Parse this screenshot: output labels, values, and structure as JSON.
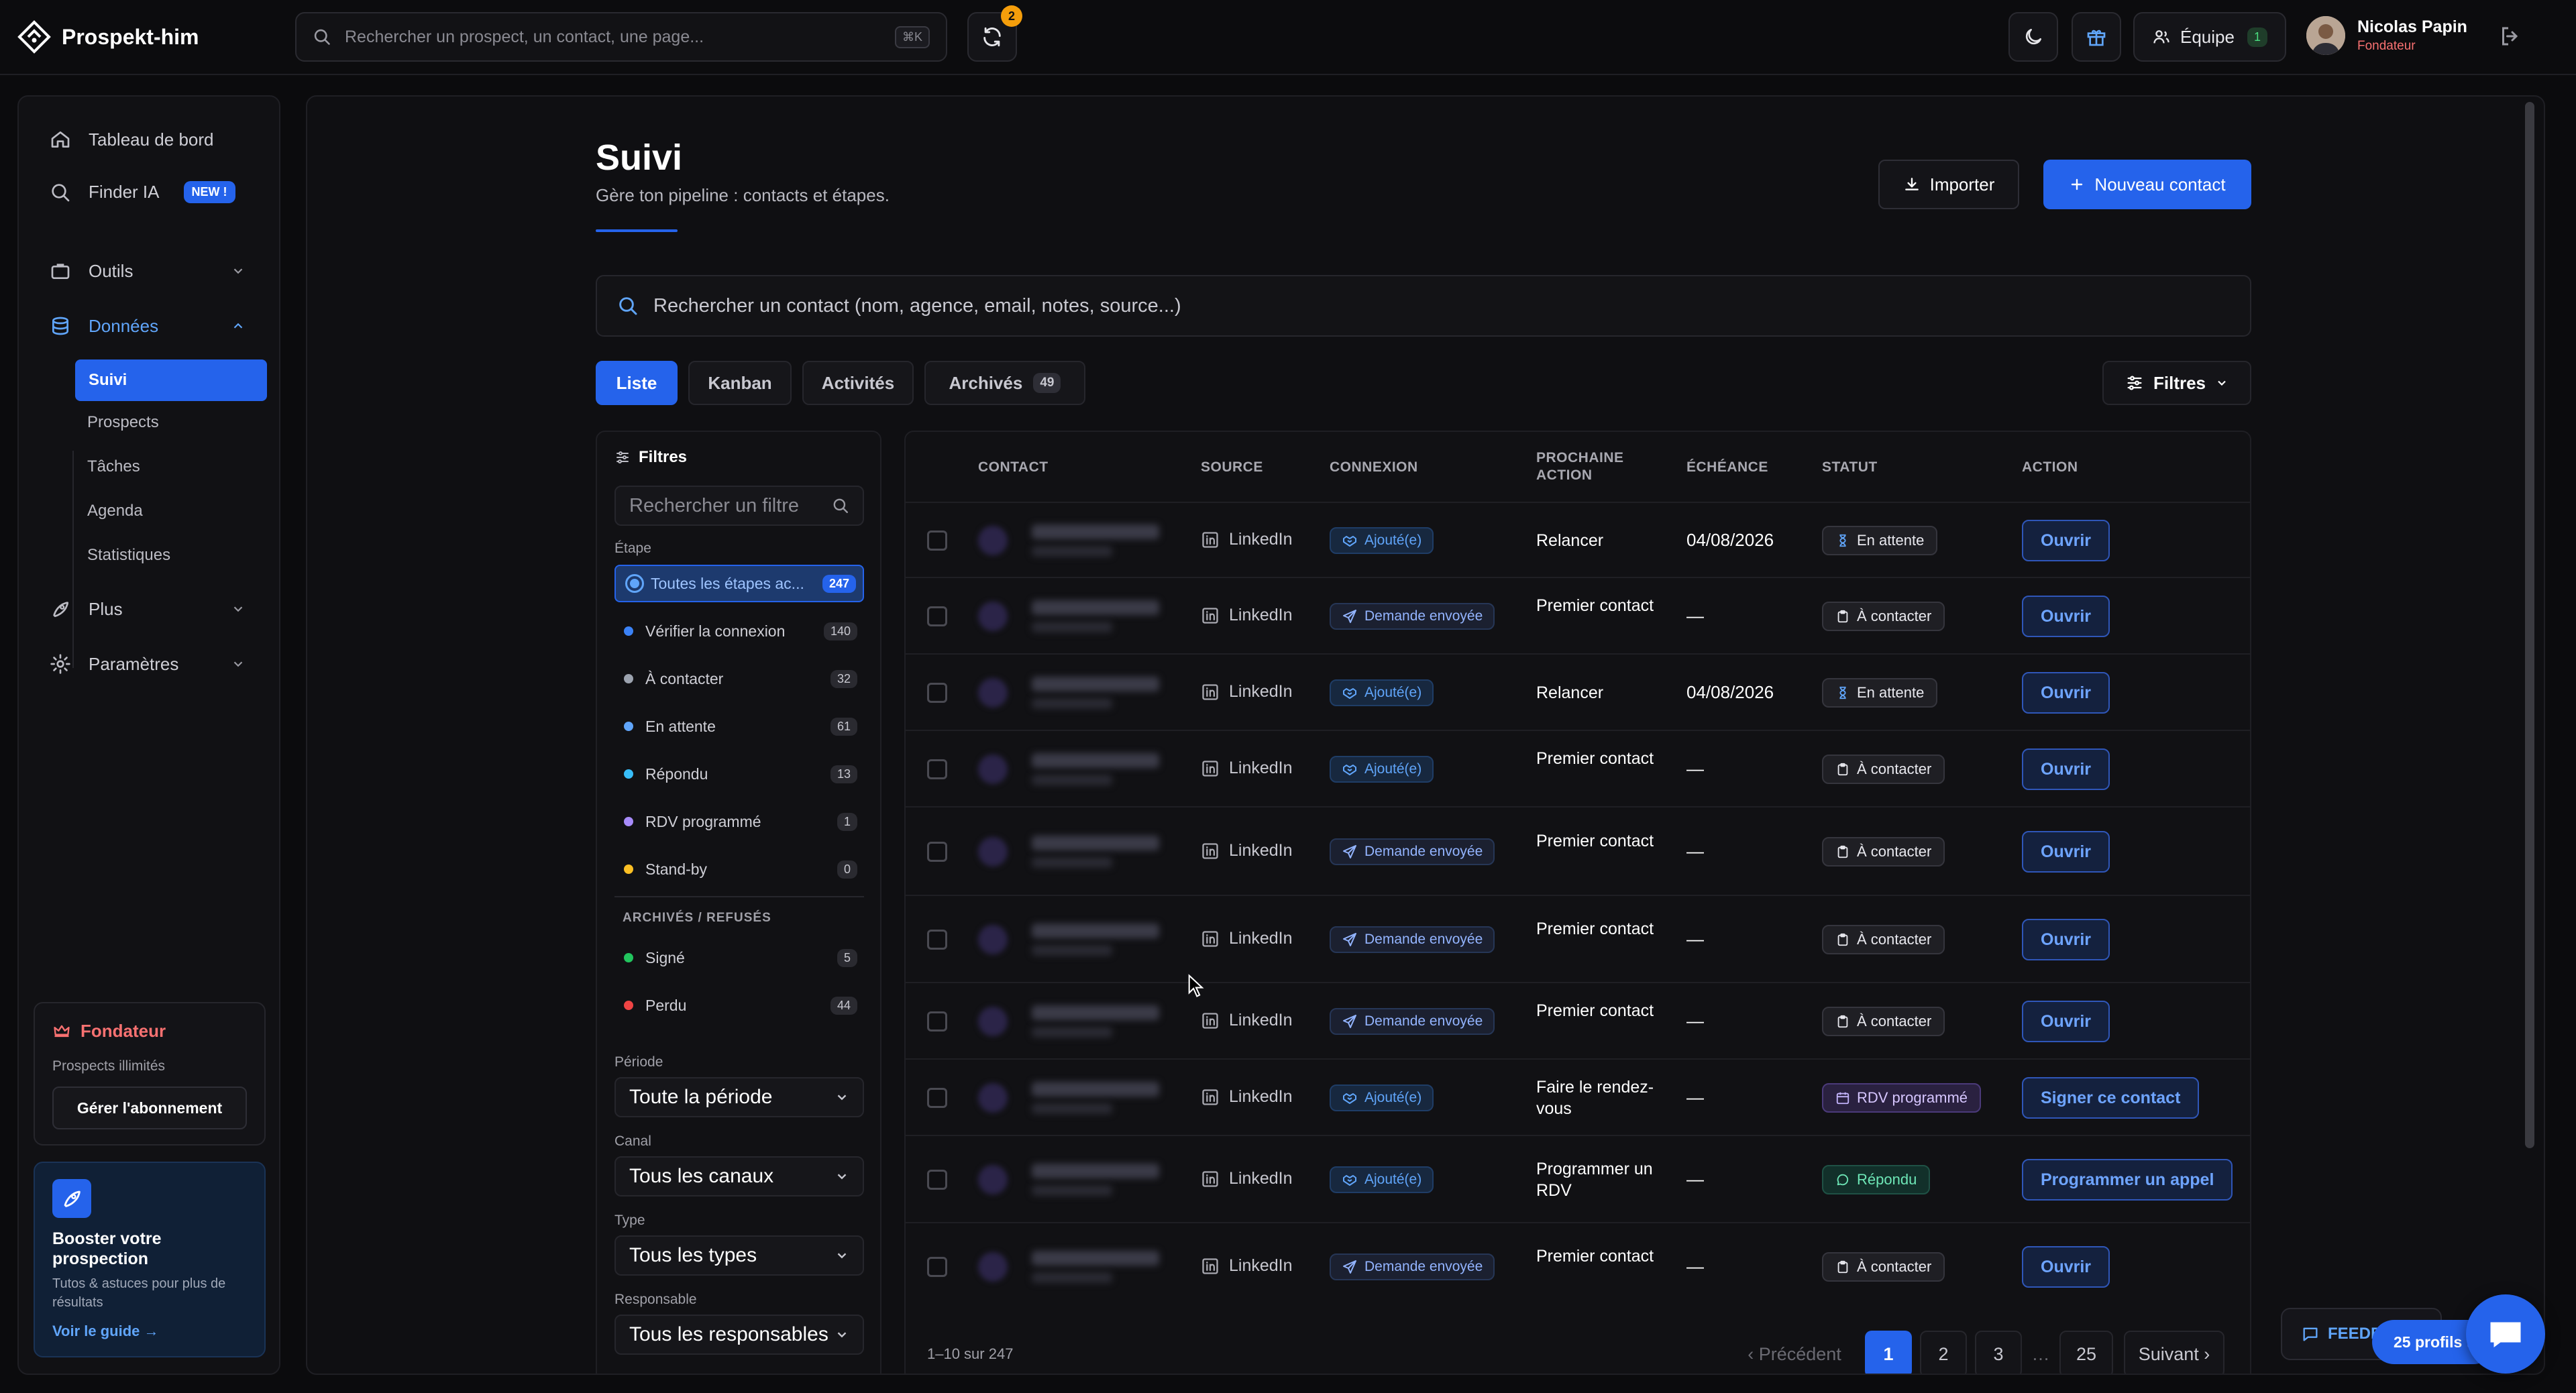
{
  "app": {
    "name": "Prospekt-him"
  },
  "topbar": {
    "search_placeholder": "Rechercher un prospect, un contact, une page...",
    "search_shortcut": "⌘K",
    "sync_badge": "2",
    "team_label": "Équipe",
    "team_count": "1",
    "user_name": "Nicolas Papin",
    "user_role": "Fondateur"
  },
  "sidebar": {
    "items": [
      {
        "label": "Tableau de bord"
      },
      {
        "label": "Finder IA",
        "badge": "NEW !"
      },
      {
        "label": "Outils"
      },
      {
        "label": "Données"
      },
      {
        "label": "Plus"
      },
      {
        "label": "Paramètres"
      }
    ],
    "sub_items": [
      "Suivi",
      "Prospects",
      "Tâches",
      "Agenda",
      "Statistiques"
    ],
    "plan": {
      "title": "Fondateur",
      "subtitle": "Prospects illimités",
      "button": "Gérer l'abonnement"
    },
    "boost": {
      "title": "Booster votre prospection",
      "desc": "Tutos & astuces pour plus de résultats",
      "link": "Voir le guide →"
    }
  },
  "page": {
    "title": "Suivi",
    "subtitle": "Gère ton pipeline : contacts et étapes.",
    "import_label": "Importer",
    "new_contact_label": "Nouveau contact",
    "search_placeholder": "Rechercher un contact (nom, agence, email, notes, source...)",
    "tabs": [
      {
        "label": "Liste"
      },
      {
        "label": "Kanban"
      },
      {
        "label": "Activités"
      },
      {
        "label": "Archivés",
        "count": "49"
      }
    ],
    "filters_label": "Filtres"
  },
  "filters": {
    "title": "Filtres",
    "search_placeholder": "Rechercher un filtre",
    "stage_label": "Étape",
    "stages": [
      {
        "label": "Toutes les étapes ac...",
        "count": "247",
        "color": "#60a5fa"
      },
      {
        "label": "Vérifier la connexion",
        "count": "140",
        "color": "#3b82f6"
      },
      {
        "label": "À contacter",
        "count": "32",
        "color": "#9ca3af"
      },
      {
        "label": "En attente",
        "count": "61",
        "color": "#60a5fa"
      },
      {
        "label": "Répondu",
        "count": "13",
        "color": "#38bdf8"
      },
      {
        "label": "RDV programmé",
        "count": "1",
        "color": "#a78bfa"
      },
      {
        "label": "Stand-by",
        "count": "0",
        "color": "#fbbf24"
      }
    ],
    "archived_label": "ARCHIVÉS / REFUSÉS",
    "archived": [
      {
        "label": "Signé",
        "count": "5",
        "color": "#22c55e"
      },
      {
        "label": "Perdu",
        "count": "44",
        "color": "#ef4444"
      }
    ],
    "period_label": "Période",
    "period_value": "Toute la période",
    "channel_label": "Canal",
    "channel_value": "Tous les canaux",
    "type_label": "Type",
    "type_value": "Tous les types",
    "owner_label": "Responsable",
    "owner_value": "Tous les responsables"
  },
  "table": {
    "headers": [
      "CONTACT",
      "SOURCE",
      "CONNEXION",
      "PROCHAINE ACTION",
      "ÉCHÉANCE",
      "STATUT",
      "ACTION"
    ],
    "rows": [
      {
        "source": "LinkedIn",
        "connexion": "Ajouté(e)",
        "conn_type": "ok",
        "next": "Relancer",
        "due": "04/08/2026",
        "status": "En attente",
        "status_type": "wait",
        "action": "Ouvrir"
      },
      {
        "source": "LinkedIn",
        "connexion": "Demande envoyée",
        "conn_type": "sent",
        "next": "Premier contact",
        "due": "—",
        "status": "À contacter",
        "status_type": "todo",
        "action": "Ouvrir"
      },
      {
        "source": "LinkedIn",
        "connexion": "Ajouté(e)",
        "conn_type": "ok",
        "next": "Relancer",
        "due": "04/08/2026",
        "status": "En attente",
        "status_type": "wait",
        "action": "Ouvrir"
      },
      {
        "source": "LinkedIn",
        "connexion": "Ajouté(e)",
        "conn_type": "ok",
        "next": "Premier contact",
        "due": "—",
        "status": "À contacter",
        "status_type": "todo",
        "action": "Ouvrir"
      },
      {
        "source": "LinkedIn",
        "connexion": "Demande envoyée",
        "conn_type": "sent",
        "next": "Premier contact",
        "due": "—",
        "status": "À contacter",
        "status_type": "todo",
        "action": "Ouvrir"
      },
      {
        "source": "LinkedIn",
        "connexion": "Demande envoyée",
        "conn_type": "sent",
        "next": "Premier contact",
        "due": "—",
        "status": "À contacter",
        "status_type": "todo",
        "action": "Ouvrir"
      },
      {
        "source": "LinkedIn",
        "connexion": "Demande envoyée",
        "conn_type": "sent",
        "next": "Premier contact",
        "due": "—",
        "status": "À contacter",
        "status_type": "todo",
        "action": "Ouvrir"
      },
      {
        "source": "LinkedIn",
        "connexion": "Ajouté(e)",
        "conn_type": "ok",
        "next": "Faire le rendez-vous",
        "due": "—",
        "status": "RDV programmé",
        "status_type": "rdv",
        "action": "Signer ce contact"
      },
      {
        "source": "LinkedIn",
        "connexion": "Ajouté(e)",
        "conn_type": "ok",
        "next": "Programmer un RDV",
        "due": "—",
        "status": "Répondu",
        "status_type": "rep",
        "action": "Programmer un appel"
      },
      {
        "source": "LinkedIn",
        "connexion": "Demande envoyée",
        "conn_type": "sent",
        "next": "Premier contact",
        "due": "—",
        "status": "À contacter",
        "status_type": "todo",
        "action": "Ouvrir"
      }
    ]
  },
  "pagination": {
    "info": "1–10 sur 247",
    "prev": "‹ Précédent",
    "pages": [
      "1",
      "2",
      "3",
      "…",
      "25"
    ],
    "next": "Suivant ›"
  },
  "widgets": {
    "feedback": "FEEDBACK",
    "profiles": "25 profils trouvés"
  },
  "colors": {
    "accent": "#2563eb",
    "background": "#0b0b0d"
  }
}
